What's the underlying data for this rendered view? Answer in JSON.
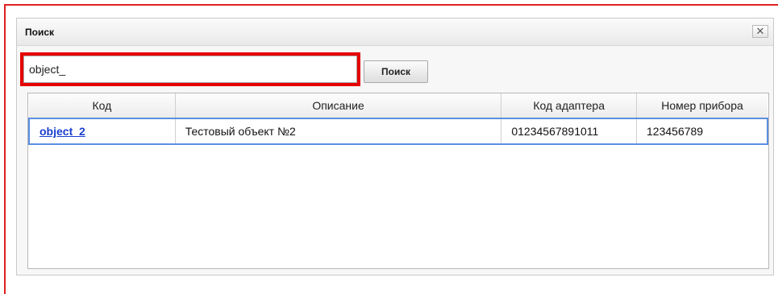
{
  "dialog": {
    "title": "Поиск",
    "close_label": "✕"
  },
  "search": {
    "value": "object_",
    "button_label": "Поиск"
  },
  "table": {
    "columns": [
      "Код",
      "Описание",
      "Код адаптера",
      "Номер прибора"
    ],
    "rows": [
      {
        "code": "object_2",
        "description": "Тестовый объект №2",
        "adapter_code": "01234567891011",
        "device_number": "123456789"
      }
    ]
  },
  "colors": {
    "highlight": "#e60000",
    "link": "#1a3fcf",
    "selection": "#5b8fe0"
  },
  "icons": {
    "close": "close-icon"
  }
}
